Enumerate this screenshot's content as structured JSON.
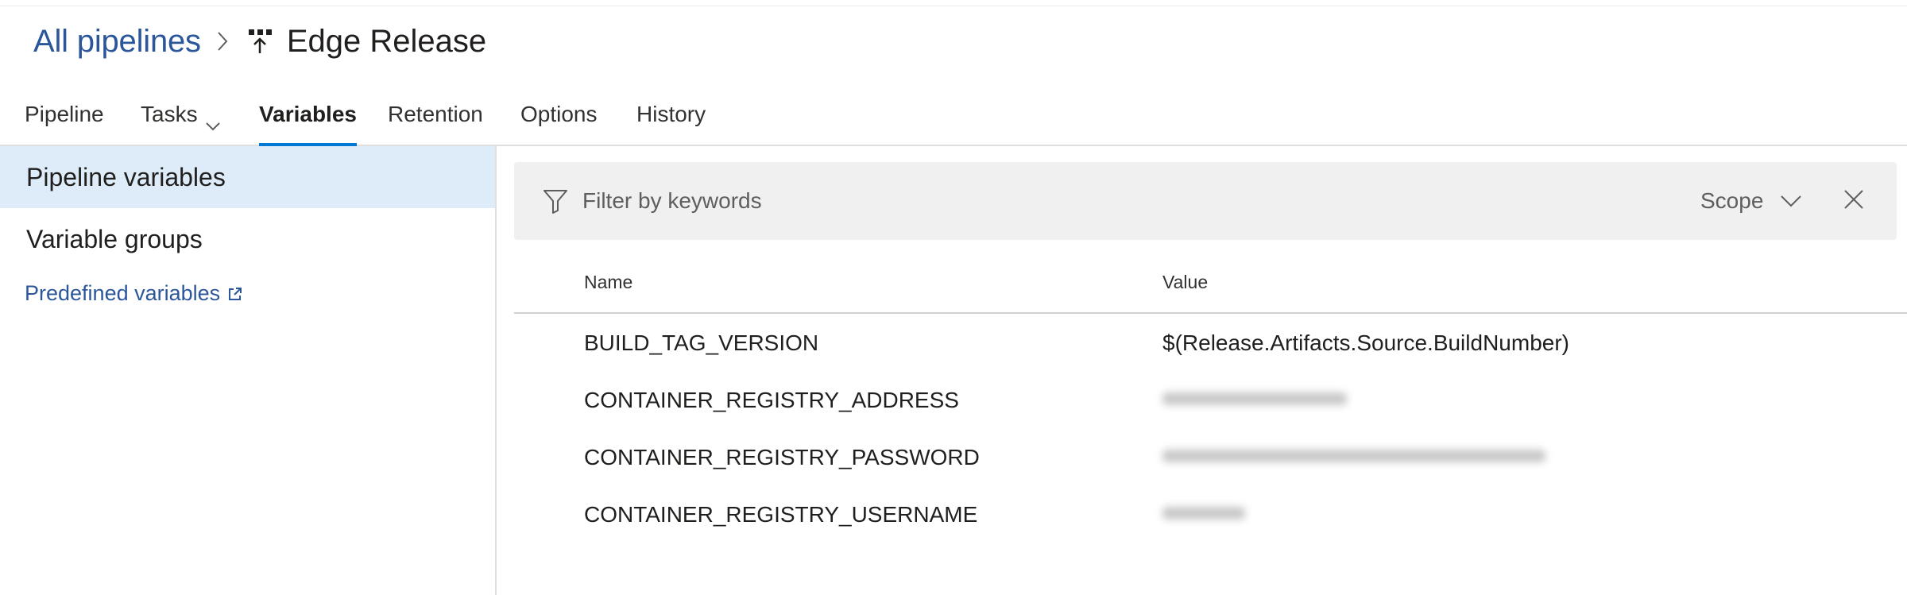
{
  "header": {
    "breadcrumb_label": "All pipelines",
    "title": "Edge Release",
    "pipeline_icon": "release-pipeline-icon"
  },
  "tabs": [
    {
      "label": "Pipeline",
      "active": false
    },
    {
      "label": "Tasks",
      "active": false,
      "has_dropdown": true
    },
    {
      "label": "Variables",
      "active": true
    },
    {
      "label": "Retention",
      "active": false
    },
    {
      "label": "Options",
      "active": false
    },
    {
      "label": "History",
      "active": false
    }
  ],
  "sidebar": {
    "items": [
      {
        "label": "Pipeline variables",
        "selected": true
      },
      {
        "label": "Variable groups",
        "selected": false
      }
    ],
    "link_label": "Predefined variables"
  },
  "filter": {
    "placeholder": "Filter by keywords",
    "scope_label": "Scope"
  },
  "table": {
    "columns": [
      "Name",
      "Value"
    ],
    "rows": [
      {
        "name": "BUILD_TAG_VERSION",
        "value": "$(Release.Artifacts.Source.BuildNumber)",
        "obscured": false
      },
      {
        "name": "CONTAINER_REGISTRY_ADDRESS",
        "value": "",
        "obscured": true
      },
      {
        "name": "CONTAINER_REGISTRY_PASSWORD",
        "value": "",
        "obscured": true
      },
      {
        "name": "CONTAINER_REGISTRY_USERNAME",
        "value": "",
        "obscured": true
      }
    ]
  },
  "colors": {
    "link": "#2b579a",
    "active_tab_underline": "#0078d4",
    "selected_item_bg": "#deecf9",
    "filter_bar_bg": "#f0f0f0"
  }
}
